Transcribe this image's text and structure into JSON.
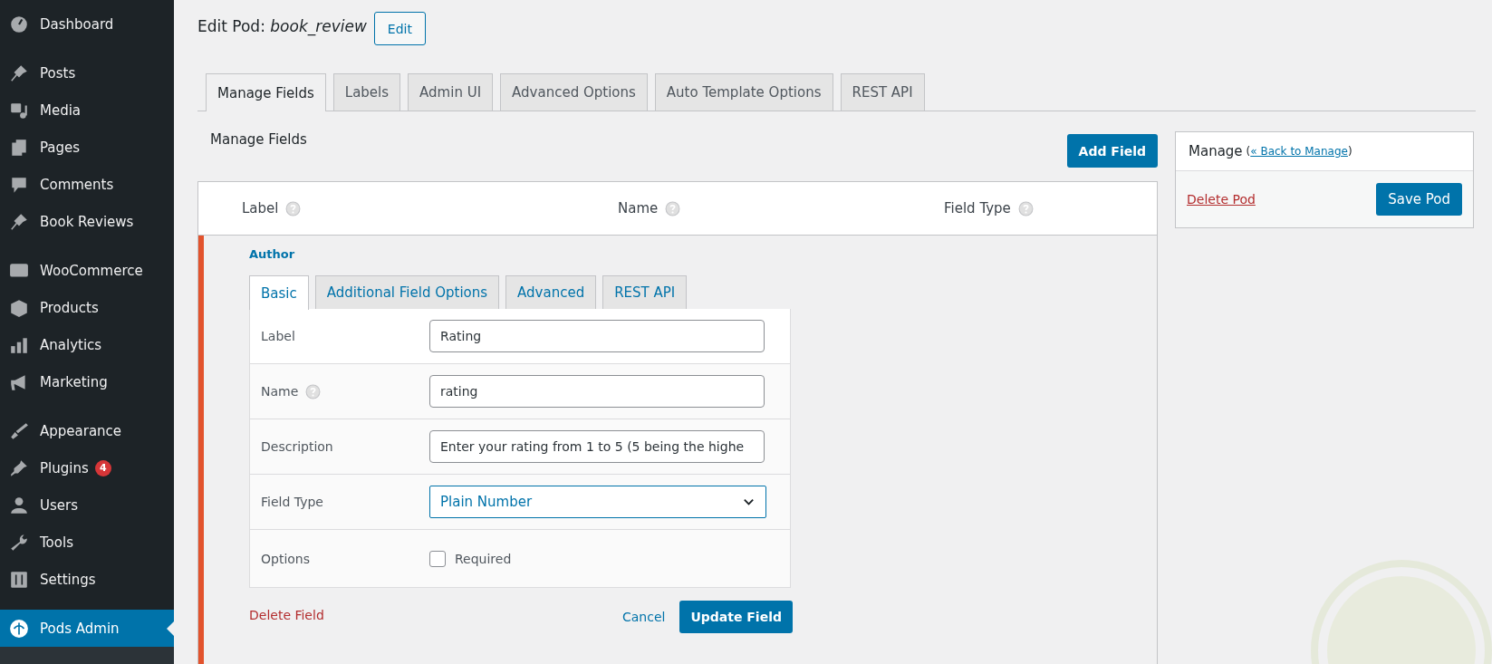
{
  "sidebar": {
    "groups": [
      [
        {
          "label": "Dashboard",
          "selected": false
        }
      ],
      [
        {
          "label": "Posts",
          "selected": false
        },
        {
          "label": "Media",
          "selected": false
        },
        {
          "label": "Pages",
          "selected": false
        },
        {
          "label": "Comments",
          "selected": false
        },
        {
          "label": "Book Reviews",
          "selected": false
        }
      ],
      [
        {
          "label": "WooCommerce",
          "selected": false
        },
        {
          "label": "Products",
          "selected": false
        },
        {
          "label": "Analytics",
          "selected": false
        },
        {
          "label": "Marketing",
          "selected": false
        }
      ],
      [
        {
          "label": "Appearance",
          "selected": false
        },
        {
          "label": "Plugins",
          "selected": false,
          "badge": "4"
        },
        {
          "label": "Users",
          "selected": false
        },
        {
          "label": "Tools",
          "selected": false
        },
        {
          "label": "Settings",
          "selected": false
        }
      ],
      [
        {
          "label": "Pods Admin",
          "selected": true
        }
      ]
    ]
  },
  "page": {
    "title": "Edit Pod:",
    "pod_name": "book_review",
    "edit_button": "Edit"
  },
  "tabs": [
    {
      "label": "Manage Fields",
      "selected": true
    },
    {
      "label": "Labels",
      "selected": false
    },
    {
      "label": "Admin UI",
      "selected": false
    },
    {
      "label": "Advanced Options",
      "selected": false
    },
    {
      "label": "Auto Template Options",
      "selected": false
    },
    {
      "label": "REST API",
      "selected": false
    }
  ],
  "manage_fields": {
    "heading": "Manage Fields",
    "add_button": "Add Field",
    "columns": [
      "Label",
      "Name",
      "Field Type"
    ],
    "field": {
      "label": "Author",
      "expanded": true,
      "tabs": [
        {
          "label": "Basic",
          "selected": true
        },
        {
          "label": "Additional Field Options",
          "selected": false
        },
        {
          "label": "Advanced",
          "selected": false
        },
        {
          "label": "REST API",
          "selected": false
        }
      ],
      "rows": [
        {
          "kind": "text",
          "label": "Label",
          "value": "Rating"
        },
        {
          "kind": "text",
          "label": "Name",
          "value": "rating",
          "help": true
        },
        {
          "kind": "text",
          "label": "Description",
          "value": "Enter your rating from 1 to 5 (5 being the highe"
        },
        {
          "kind": "select",
          "label": "Field Type",
          "value": "Plain Number"
        },
        {
          "kind": "checkbox",
          "label": "Options",
          "option": "Required",
          "checked": false
        }
      ],
      "delete": "Delete Field",
      "cancel": "Cancel",
      "update": "Update Field"
    }
  },
  "manage_box": {
    "title": "Manage",
    "paren_open": "(",
    "back_link": "« Back to Manage",
    "paren_close": ")",
    "delete": "Delete Pod",
    "save": "Save Pod"
  }
}
